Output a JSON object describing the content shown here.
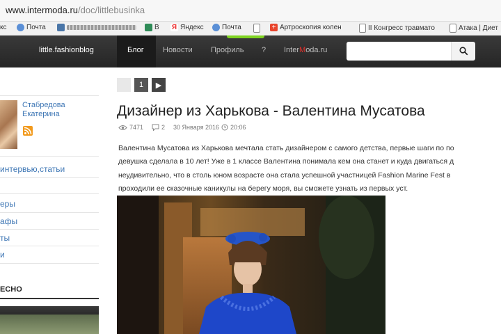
{
  "browser": {
    "url_domain": "www.intermoda.ru",
    "url_path": "/doc/littlebusinka",
    "bookmarks": [
      {
        "label": "кс",
        "icon": "none"
      },
      {
        "label": "Почта",
        "icon": "mail-icon",
        "color": "#5a8fd6"
      },
      {
        "label": "",
        "icon": "vk-icon",
        "color": "#4a76a8",
        "blurred": true
      },
      {
        "label": "В",
        "icon": "b-icon",
        "color": "#2e8b57"
      },
      {
        "label": "Яндекс",
        "icon": "yandex-icon",
        "color": "#e33"
      },
      {
        "label": "Почта",
        "icon": "mail-icon",
        "color": "#5a8fd6"
      },
      {
        "label": "",
        "icon": "page-icon"
      },
      {
        "label": "Артроскопия колен",
        "icon": "plus-icon",
        "color": "#e8442c"
      },
      {
        "label": "II Конгресс травмато",
        "icon": "page-icon"
      },
      {
        "label": "Атака | Диет",
        "icon": "page-icon"
      }
    ]
  },
  "header": {
    "site_name": "little.fashionblog",
    "nav": [
      "Блог",
      "Новости",
      "Профиль",
      "?"
    ],
    "brand_pre": "Inter",
    "brand_red": "M",
    "brand_post": "oda.ru",
    "search_placeholder": ""
  },
  "sidebar": {
    "author": "Стабредова Екатерина",
    "links": [
      "интервью,статьи",
      "еры",
      "афы",
      "ты",
      "и"
    ],
    "heading": "ЕСНО"
  },
  "pager": {
    "page": "1",
    "next": "▶"
  },
  "article": {
    "title": "Дизайнер из Харькова - Валентина Мусатова",
    "views": "7471",
    "comments": "2",
    "date": "30 Января 2016",
    "time": "20:06",
    "paragraph": [
      "Валентина Мусатова из Харькова мечтала стать дизайнером с самого детства, первые шаги по по",
      "девушка сделала в 10 лет! Уже в 1 классе Валентина понимала кем она станет и куда двигаться д",
      "неудивительно, что в столь юном возрасте она стала успешной участницей Fashion Marine Fest в",
      "проходили ее сказочные каникулы на берегу моря, вы сможете узнать из первых уст."
    ]
  },
  "colors": {
    "nav_bg": "#2e2e2e",
    "link_blue": "#3f77b5",
    "brand_red": "#e0312b",
    "accent_green": "#7ed321",
    "rss_orange": "#f29a1d"
  }
}
